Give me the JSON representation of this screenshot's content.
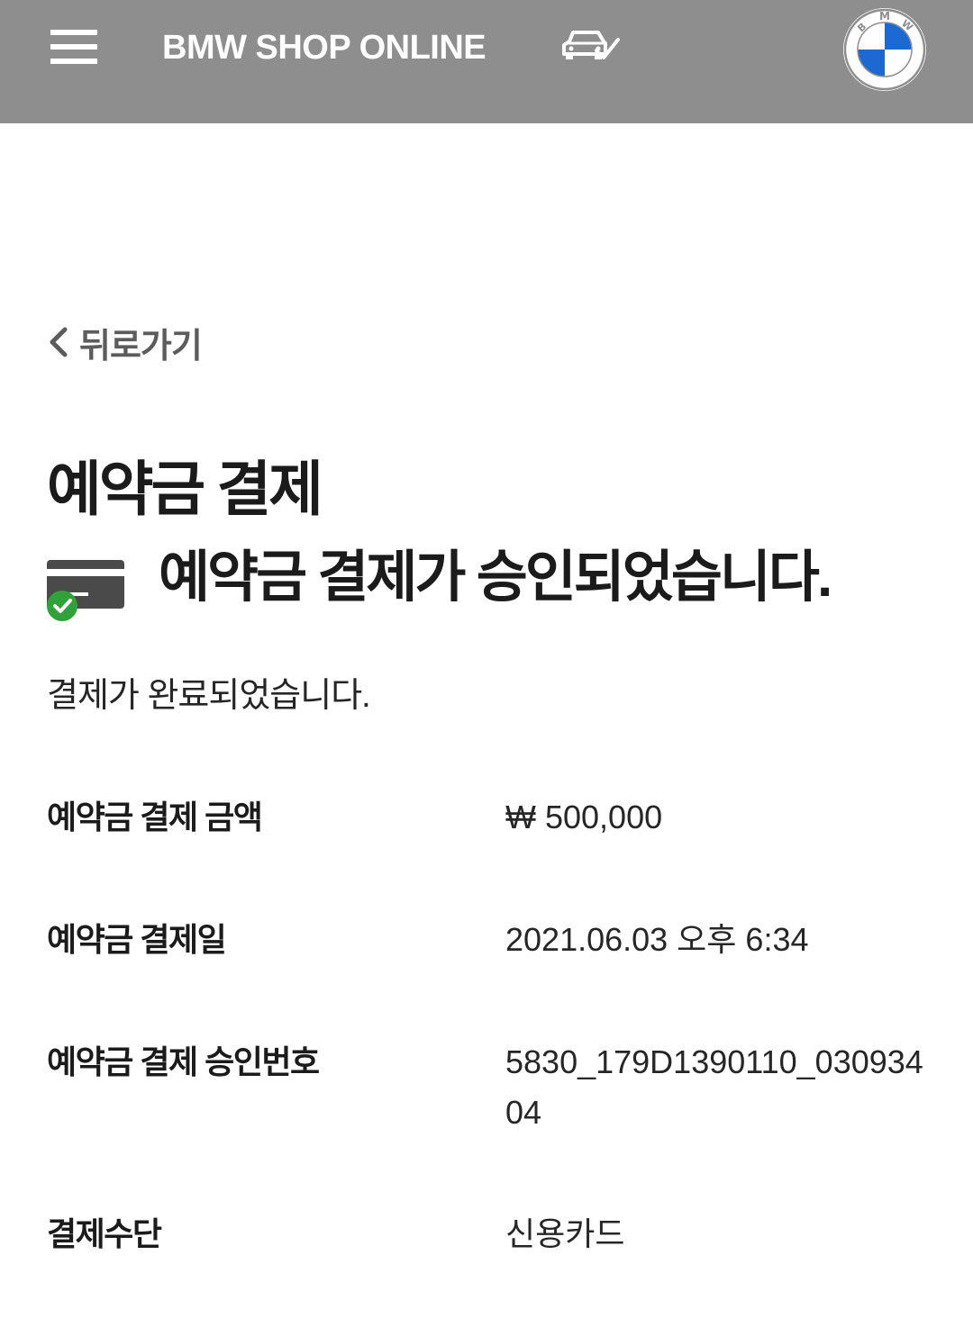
{
  "header": {
    "brand": "BMW SHOP ONLINE",
    "menu_icon": "hamburger-menu-icon",
    "car_icon": "car-check-icon",
    "logo_icon": "bmw-roundel-logo",
    "background": "#8e8e8e"
  },
  "back": {
    "label": "뒤로가기",
    "icon": "chevron-left-icon"
  },
  "main": {
    "title": "예약금 결제",
    "approval_message": "예약금 결제가 승인되었습니다.",
    "approval_icon": "credit-card-check-icon",
    "complete_message": "결제가 완료되었습니다.",
    "details": [
      {
        "label": "예약금 결제 금액",
        "value": "₩ 500,000"
      },
      {
        "label": "예약금 결제일",
        "value": "2021.06.03 오후 6:34"
      },
      {
        "label": "예약금 결제 승인번호",
        "value": "5830_179D1390110_03093404"
      },
      {
        "label": "결제수단",
        "value": "신용카드"
      }
    ]
  },
  "colors": {
    "bmw_blue": "#1c69d4",
    "check_green": "#2fa23a",
    "card_dark": "#4a4a4a"
  }
}
